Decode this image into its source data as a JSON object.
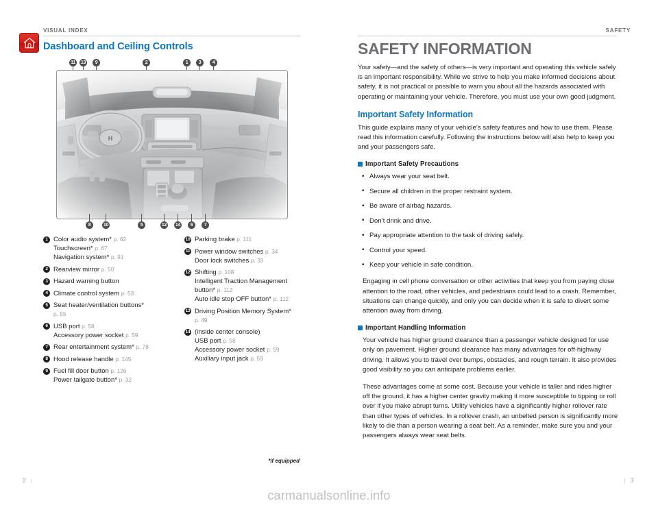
{
  "left_page": {
    "section_label": "VISUAL INDEX",
    "home_icon": "home-icon",
    "chapter_title": "Dashboard and Ceiling Controls",
    "illustration": {
      "name": "dashboard-and-ceiling-controls-illustration",
      "top_callouts": [
        "11",
        "13",
        "9",
        "2",
        "1",
        "3",
        "4"
      ],
      "bottom_callouts": [
        "8",
        "10",
        "5",
        "12",
        "14",
        "6",
        "7"
      ]
    },
    "index_column_left": [
      {
        "number": "1",
        "lines": [
          {
            "label": "Color audio system*",
            "page": "p. 62"
          },
          {
            "label": "Touchscreen*",
            "page": "p. 67"
          },
          {
            "label": "Navigation system*",
            "page": "p. 91"
          }
        ]
      },
      {
        "number": "2",
        "lines": [
          {
            "label": "Rearview mirror",
            "page": "p. 50"
          }
        ]
      },
      {
        "number": "3",
        "lines": [
          {
            "label": "Hazard warning button",
            "page": ""
          }
        ]
      },
      {
        "number": "4",
        "lines": [
          {
            "label": "Climate control system",
            "page": "p. 53"
          }
        ]
      },
      {
        "number": "5",
        "lines": [
          {
            "label": "Seat heater/ventilation buttons*",
            "page": ""
          },
          {
            "label": "",
            "page": "p. 55"
          }
        ]
      },
      {
        "number": "6",
        "lines": [
          {
            "label": "USB port",
            "page": "p. 58"
          },
          {
            "label": "Accessory power socket",
            "page": "p. 59"
          }
        ]
      },
      {
        "number": "7",
        "lines": [
          {
            "label": "Rear entertainment system*",
            "page": "p. 78"
          }
        ]
      },
      {
        "number": "8",
        "lines": [
          {
            "label": "Hood release handle",
            "page": "p. 145"
          }
        ]
      },
      {
        "number": "9",
        "lines": [
          {
            "label": "Fuel fill door button",
            "page": "p. 126"
          },
          {
            "label": "Power tailgate button*",
            "page": "p. 32"
          }
        ]
      }
    ],
    "index_column_right": [
      {
        "number": "10",
        "lines": [
          {
            "label": "Parking brake",
            "page": "p. 111"
          }
        ]
      },
      {
        "number": "11",
        "lines": [
          {
            "label": "Power window switches",
            "page": "p. 34"
          },
          {
            "label": "Door lock switches",
            "page": "p. 33"
          }
        ]
      },
      {
        "number": "12",
        "lines": [
          {
            "label": "Shifting",
            "page": "p. 108"
          },
          {
            "label": "Intelligent Traction Management",
            "page": ""
          },
          {
            "label": "button*",
            "page": "p. 112"
          },
          {
            "label": "Auto idle stop OFF button*",
            "page": "p. 112"
          }
        ]
      },
      {
        "number": "13",
        "lines": [
          {
            "label": "Driving Position Memory System*",
            "page": ""
          },
          {
            "label": "",
            "page": "p. 49"
          }
        ]
      },
      {
        "number": "14",
        "lines": [
          {
            "label": "(inside center console)",
            "page": ""
          },
          {
            "label": "USB port",
            "page": "p. 58"
          },
          {
            "label": "Accessory power socket",
            "page": "p. 59"
          },
          {
            "label": "Auxiliary input jack",
            "page": "p. 59"
          }
        ]
      }
    ],
    "footnote": "*if equipped",
    "folio": "2",
    "folio_bar": "|"
  },
  "right_page": {
    "section_label": "SAFETY",
    "title": "SAFETY INFORMATION",
    "intro_paragraph": "Your safety—and the safety of others—is very important and operating this vehicle safely is an important responsibility. While we strive to help you make informed decisions about safety, it is not practical or possible to warn you about all the hazards associated with operating or maintaining your vehicle. Therefore, you must use your own good judgment.",
    "important_safety_information_heading": "Important Safety Information",
    "important_safety_information_paragraph": "This guide explains many of your vehicle’s safety features and how to use them. Please read this information carefully. Following the instructions below will also help to keep you and your passengers safe.",
    "precautions_heading": "Important Safety Precautions",
    "precautions": [
      "Always wear your seat belt.",
      "Secure all children in the proper restraint system.",
      "Be aware of airbag hazards.",
      "Don’t drink and drive.",
      "Pay appropriate attention to the task of driving safely.",
      "Control your speed.",
      "Keep your vehicle in safe condition."
    ],
    "cellphone_paragraph": "Engaging in cell phone conversation or other activities that keep you from paying close attention to the road, other vehicles, and pedestrians could lead to a crash. Remember, situations can change quickly, and only you can decide when it is safe to divert some attention away from driving.",
    "handling_heading": "Important Handling Information",
    "handling_paragraph_1": "Your vehicle has higher ground clearance than a passenger vehicle designed for use only on pavement. Higher ground clearance has many advantages for off-highway driving. It allows you to travel over bumps, obstacles, and rough terrain. It also provides good visibility so you can anticipate problems earlier.",
    "handling_paragraph_2": "These advantages come at some cost. Because your vehicle is taller and rides higher off the ground, it has a higher center gravity making it more susceptible to tipping or roll over if you make abrupt turns. Utility vehicles have a significantly higher rollover rate than other types of vehicles. In a rollover crash, an unbelted person is significantly more likely to die than a person wearing a seat belt. As a reminder, make sure you and your passengers always wear seat belts.",
    "folio": "3",
    "folio_bar": "|"
  },
  "watermark": "carmanualsonline.info",
  "colors": {
    "blue": "#0d76bd",
    "red": "#cf1f18",
    "gray_heading": "#6d6e71",
    "page_number": "#939598"
  }
}
